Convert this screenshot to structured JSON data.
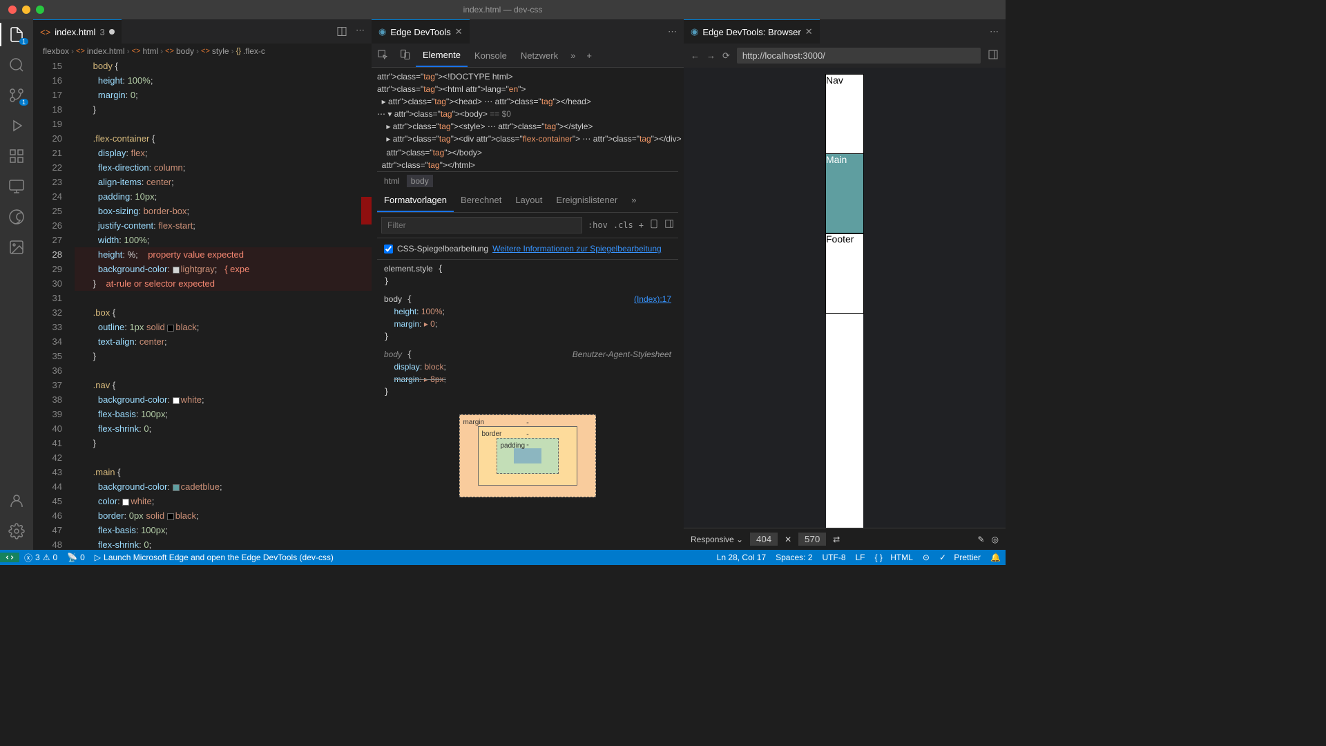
{
  "window": {
    "title": "index.html — dev-css"
  },
  "activity": {
    "explorer_badge": "1",
    "scm_badge": "1"
  },
  "tabs": {
    "editor": {
      "filename": "index.html",
      "problems": "3"
    },
    "devtools": "Edge DevTools",
    "browser": "Edge DevTools: Browser"
  },
  "breadcrumb": [
    "flexbox",
    "index.html",
    "html",
    "body",
    "style",
    ".flex-c"
  ],
  "code": {
    "start": 15,
    "lines": [
      {
        "n": 15,
        "html": "      <span class='k-sel'>body</span> {"
      },
      {
        "n": 16,
        "html": "        <span class='k-prop'>height</span>: <span class='k-num'>100%</span>;"
      },
      {
        "n": 17,
        "html": "        <span class='k-prop'>margin</span>: <span class='k-num'>0</span>;"
      },
      {
        "n": 18,
        "html": "      }"
      },
      {
        "n": 19,
        "html": ""
      },
      {
        "n": 20,
        "html": "      <span class='k-sel'>.flex-container</span> {"
      },
      {
        "n": 21,
        "html": "        <span class='k-prop'>display</span>: <span class='k-val'>flex</span>;"
      },
      {
        "n": 22,
        "html": "        <span class='k-prop'>flex-direction</span>: <span class='k-val'>column</span>;"
      },
      {
        "n": 23,
        "html": "        <span class='k-prop'>align-items</span>: <span class='k-val'>center</span>;"
      },
      {
        "n": 24,
        "html": "        <span class='k-prop'>padding</span>: <span class='k-num'>10px</span>;"
      },
      {
        "n": 25,
        "html": "        <span class='k-prop'>box-sizing</span>: <span class='k-val'>border-box</span>;"
      },
      {
        "n": 26,
        "html": "        <span class='k-prop'>justify-content</span>: <span class='k-val'>flex-start</span>;"
      },
      {
        "n": 27,
        "html": "        <span class='k-prop'>width</span>: <span class='k-num'>100%</span>;"
      },
      {
        "n": 28,
        "html": "        <span class='k-prop'>height</span>: <span class='k-punc'>%</span>;    <span class='k-err'>property value expected</span>",
        "err": true,
        "cur": true
      },
      {
        "n": 29,
        "html": "        <span class='k-prop'>background-color</span>: <span class='swatch' style='background:#d3d3d3'></span><span class='k-val'>lightgray</span>;   <span class='k-err'>{ expe</span>",
        "err": true
      },
      {
        "n": 30,
        "html": "      <span class='k-punc'>}</span>    <span class='k-err'>at-rule or selector expected</span>",
        "err": true
      },
      {
        "n": 31,
        "html": ""
      },
      {
        "n": 32,
        "html": "      <span class='k-sel'>.box</span> {"
      },
      {
        "n": 33,
        "html": "        <span class='k-prop'>outline</span>: <span class='k-num'>1px</span> <span class='k-val'>solid</span> <span class='swatch' style='background:#000'></span><span class='k-val'>black</span>;"
      },
      {
        "n": 34,
        "html": "        <span class='k-prop'>text-align</span>: <span class='k-val'>center</span>;"
      },
      {
        "n": 35,
        "html": "      }"
      },
      {
        "n": 36,
        "html": ""
      },
      {
        "n": 37,
        "html": "      <span class='k-sel'>.nav</span> {"
      },
      {
        "n": 38,
        "html": "        <span class='k-prop'>background-color</span>: <span class='swatch' style='background:#fff'></span><span class='k-val'>white</span>;"
      },
      {
        "n": 39,
        "html": "        <span class='k-prop'>flex-basis</span>: <span class='k-num'>100px</span>;"
      },
      {
        "n": 40,
        "html": "        <span class='k-prop'>flex-shrink</span>: <span class='k-num'>0</span>;"
      },
      {
        "n": 41,
        "html": "      }"
      },
      {
        "n": 42,
        "html": ""
      },
      {
        "n": 43,
        "html": "      <span class='k-sel'>.main</span> {"
      },
      {
        "n": 44,
        "html": "        <span class='k-prop'>background-color</span>: <span class='swatch' style='background:#5f9ea0'></span><span class='k-val'>cadetblue</span>;"
      },
      {
        "n": 45,
        "html": "        <span class='k-prop'>color</span>: <span class='swatch' style='background:#fff'></span><span class='k-val'>white</span>;"
      },
      {
        "n": 46,
        "html": "        <span class='k-prop'>border</span>: <span class='k-num'>0px</span> <span class='k-val'>solid</span> <span class='swatch' style='background:#000'></span><span class='k-val'>black</span>;"
      },
      {
        "n": 47,
        "html": "        <span class='k-prop'>flex-basis</span>: <span class='k-num'>100px</span>;"
      },
      {
        "n": 48,
        "html": "        <span class='k-prop'>flex-shrink</span>: <span class='k-num'>0</span>;"
      }
    ]
  },
  "devtools": {
    "tabs": [
      "Elemente",
      "Konsole",
      "Netzwerk"
    ],
    "dom": [
      "<!DOCTYPE html>",
      "<html lang=\"en\">",
      "  ▸ <head> ⋯ </head>",
      "⋯ ▾ <body> == $0",
      "    ▸ <style> ⋯ </style>",
      "    ▸ <div class=\"flex-container\"> ⋯ </div> [flex]",
      "    </body>",
      "  </html>"
    ],
    "bc": [
      "html",
      "body"
    ],
    "styles_tabs": [
      "Formatvorlagen",
      "Berechnet",
      "Layout",
      "Ereignislistener"
    ],
    "filter_placeholder": "Filter",
    "hov": ":hov",
    "cls": ".cls",
    "mirror": "CSS-Spiegelbearbeitung",
    "mirror_link": "Weitere Informationen zur Spiegelbearbeitung",
    "rules": [
      {
        "sel": "element.style",
        "props": [],
        "src": ""
      },
      {
        "sel": "body",
        "props": [
          [
            "height",
            "100%"
          ],
          [
            "margin",
            "▸ 0"
          ]
        ],
        "src": "(Index):17",
        "link": true
      },
      {
        "sel": "body",
        "props": [
          [
            "display",
            "block"
          ],
          [
            "margin",
            "▸ 8px",
            true
          ]
        ],
        "src": "Benutzer-Agent-Stylesheet",
        "ua": true
      }
    ],
    "box": {
      "margin": "-",
      "border": "-",
      "padding": "-"
    }
  },
  "browser": {
    "url": "http://localhost:3000/",
    "boxes": [
      "Nav",
      "Main",
      "Footer"
    ],
    "device": "Responsive",
    "w": "404",
    "h": "570"
  },
  "status": {
    "remote": "",
    "errors": "3",
    "warnings": "0",
    "ports": "0",
    "launch": "Launch Microsoft Edge and open the Edge DevTools (dev-css)",
    "cursor": "Ln 28, Col 17",
    "spaces": "Spaces: 2",
    "encoding": "UTF-8",
    "eol": "LF",
    "lang": "HTML",
    "prettier": "Prettier"
  }
}
